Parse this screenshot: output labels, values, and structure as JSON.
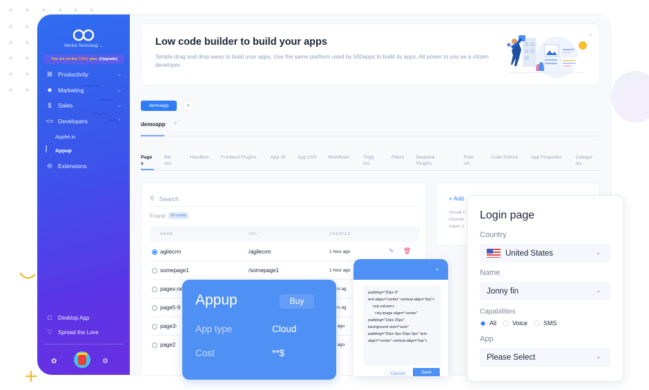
{
  "sidebar": {
    "org_name": "Mantra Technologi",
    "plan_prefix": "You are on the ",
    "plan_name": "FREE",
    "plan_mid": " plan. ",
    "plan_upgrade": "[Upgrade]",
    "items": [
      {
        "label": "Productivity",
        "icon": "command-icon",
        "expanded": false
      },
      {
        "label": "Marketing",
        "icon": "target-icon",
        "expanded": false
      },
      {
        "label": "Sales",
        "icon": "dollar-icon",
        "expanded": false
      },
      {
        "label": "Developers",
        "icon": "code-icon",
        "expanded": true
      },
      {
        "label": "Extensions",
        "icon": "extensions-icon"
      }
    ],
    "sub_items": [
      {
        "label": "Applet.io",
        "active": false
      },
      {
        "label": "Appup",
        "active": true
      }
    ],
    "bottom_items": [
      {
        "label": "Desktop App",
        "icon": "monitor-icon"
      },
      {
        "label": "Spread the Love",
        "icon": "heart-icon"
      }
    ]
  },
  "banner": {
    "title": "Low code builder to build your apps",
    "description": "Simple drag and drop away to build your apps. Use the same platform used by 500apps to build its apps. All power to you as a citizen developer."
  },
  "app_tabs": {
    "primary": "demoapp",
    "secondary": "demoapp"
  },
  "sub_tabs": [
    {
      "label": "Page\ns",
      "active": true
    },
    {
      "label": "Blo\ncks"
    },
    {
      "label": "Handlers"
    },
    {
      "label": "Frontend Plugins"
    },
    {
      "label": "App JS"
    },
    {
      "label": "App CSS"
    },
    {
      "label": "Workflows"
    },
    {
      "label": "Trigg\ners"
    },
    {
      "label": "Filters"
    },
    {
      "label": "Backend\nPlugins"
    },
    {
      "label": "Publ\nish"
    },
    {
      "label": "Code Editors"
    },
    {
      "label": "App Properties"
    },
    {
      "label": "Categor\nies"
    }
  ],
  "list": {
    "search_placeholder": "Search",
    "found_label": "Found",
    "found_badge": "18 results",
    "columns": [
      "NAME",
      "URL",
      "CREATED"
    ],
    "rows": [
      {
        "name": "agilecrm",
        "url": "/agilecrm",
        "created": "1 hour ago",
        "selected": true
      },
      {
        "name": "somepage1",
        "url": "/somepage1",
        "created": "1 hour ago",
        "selected": false
      },
      {
        "name": "pages-ne",
        "url": "",
        "created": "hours ag",
        "selected": false
      },
      {
        "name": "page5-9",
        "url": "",
        "created": "hours ag",
        "selected": false
      },
      {
        "name": "page3-",
        "url": "",
        "created": "ays ago",
        "selected": false
      },
      {
        "name": "page2",
        "url": "",
        "created": "ays ago",
        "selected": false
      }
    ]
  },
  "add_card": {
    "add_label": "+  Add",
    "description": "Visual c\nchoose\nsuper s"
  },
  "appup_card": {
    "title": "Appup",
    "buy_label": "Buy",
    "app_type_label": "App type",
    "app_type_value": "Cloud",
    "cost_label": "Cost",
    "cost_value": "**$"
  },
  "editor_card": {
    "code": "padding=\"20px 0\"\ntext-align=\"center\" vertical-align=\"top\">\n    <mj-column>\n      <mj-image align=\"center\"\npadding=\"10px 25px\"\nbackground-size=\"auto\"\npadding=\"20px 0px 20px 0px\" text-align=\"center\" vertical-align=\"top\">",
    "cancel_label": "Cancel",
    "save_label": "Save"
  },
  "login_card": {
    "title": "Login page",
    "country_label": "Country",
    "country_value": "United States",
    "name_label": "Name",
    "name_value": "Jonny fin",
    "capabilities_label": "Capabilities",
    "capabilities": [
      {
        "label": "All",
        "selected": true
      },
      {
        "label": "Voice",
        "selected": false
      },
      {
        "label": "SMS",
        "selected": false
      }
    ],
    "app_label": "App",
    "app_value": "Please Select"
  },
  "colors": {
    "accent": "#2f7cf6",
    "card_blue": "#4f90f5",
    "delete": "#ef4f6e",
    "decor_yellow": "#f5b21f"
  }
}
